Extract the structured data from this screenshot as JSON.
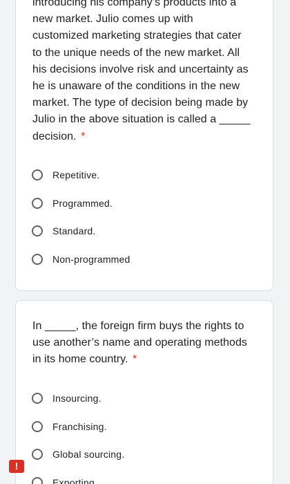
{
  "questions": [
    {
      "lines": [
        "introducing his company’s products into a",
        "new market. Julio comes up with",
        "customized marketing strategies that cater",
        "to the unique needs of the new market. All",
        "his decisions involve risk and uncertainty as",
        "he is unaware of the conditions in the new",
        "market. The type of decision being made by",
        "Julio in the above situation is called a _____",
        "decision."
      ],
      "required_mark": "*",
      "options": [
        "Repetitive.",
        "Programmed.",
        "Standard.",
        "Non-programmed"
      ]
    },
    {
      "lines": [
        "In _____, the foreign firm buys the rights to",
        "use another’s name and operating methods",
        "in its home country."
      ],
      "required_mark": "*",
      "options": [
        "Insourcing.",
        "Franchising.",
        "Global sourcing.",
        "Exporting"
      ]
    }
  ],
  "feedback_badge": {
    "label": "!",
    "icon": "exclamation-icon"
  },
  "colors": {
    "background": "#f1f3f4",
    "card": "#ffffff",
    "required": "#d93025",
    "radio_border": "#5f6368",
    "text": "#202124"
  }
}
